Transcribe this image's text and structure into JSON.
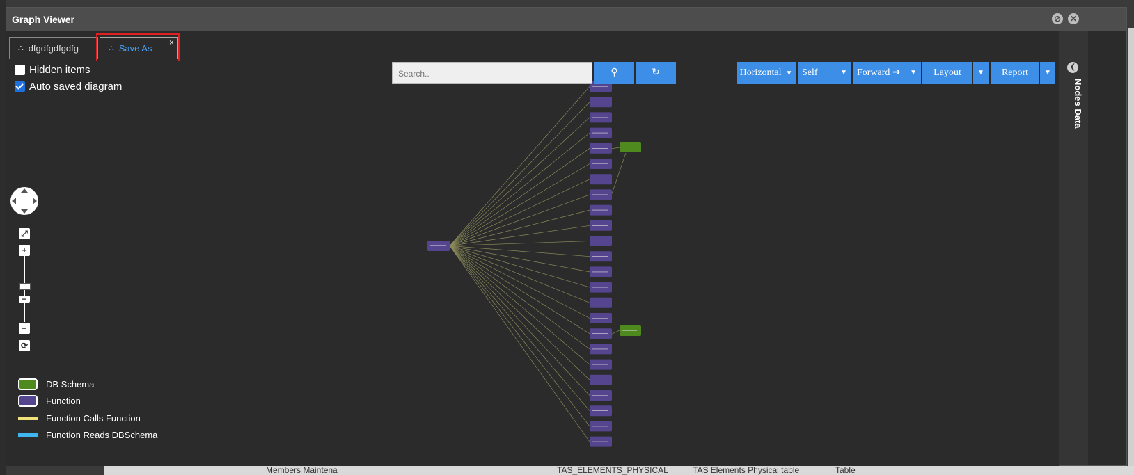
{
  "window": {
    "title": "Graph Viewer"
  },
  "tabs": [
    {
      "label": "dfgdfgdfgdfg",
      "icon": "sitemap-icon",
      "active": false
    },
    {
      "label": "Save As",
      "icon": "sitemap-icon",
      "active": true,
      "close": "×"
    }
  ],
  "options": {
    "hidden_items": {
      "label": "Hidden items",
      "checked": false
    },
    "auto_saved": {
      "label": "Auto saved diagram",
      "checked": true
    }
  },
  "toolbar": {
    "search_placeholder": "Search..",
    "orientation": "Horizontal",
    "scope": "Self",
    "direction": "Forward",
    "layout": "Layout",
    "report": "Report"
  },
  "side_panel": {
    "label": "Nodes Data"
  },
  "legend": [
    {
      "label": "DB Schema",
      "color": "#4f8a1e",
      "kind": "box"
    },
    {
      "label": "Function",
      "color": "#55458f",
      "kind": "box"
    },
    {
      "label": "Function Calls Function",
      "color": "#f2e17a",
      "kind": "line"
    },
    {
      "label": "Function Reads DBSchema",
      "color": "#3fb6f0",
      "kind": "line"
    }
  ],
  "colors": {
    "accent": "#3d8ee6",
    "function_node": "#55458f",
    "schema_node": "#4f8a1e",
    "edge": "#8a8a5a"
  },
  "graph": {
    "function_node_count": 24,
    "schema_node_count": 2
  },
  "background": {
    "bottom_cells": [
      "Members Maintena",
      "TAS_ELEMENTS_PHYSICAL",
      "TAS Elements Physical table",
      "Table"
    ]
  }
}
